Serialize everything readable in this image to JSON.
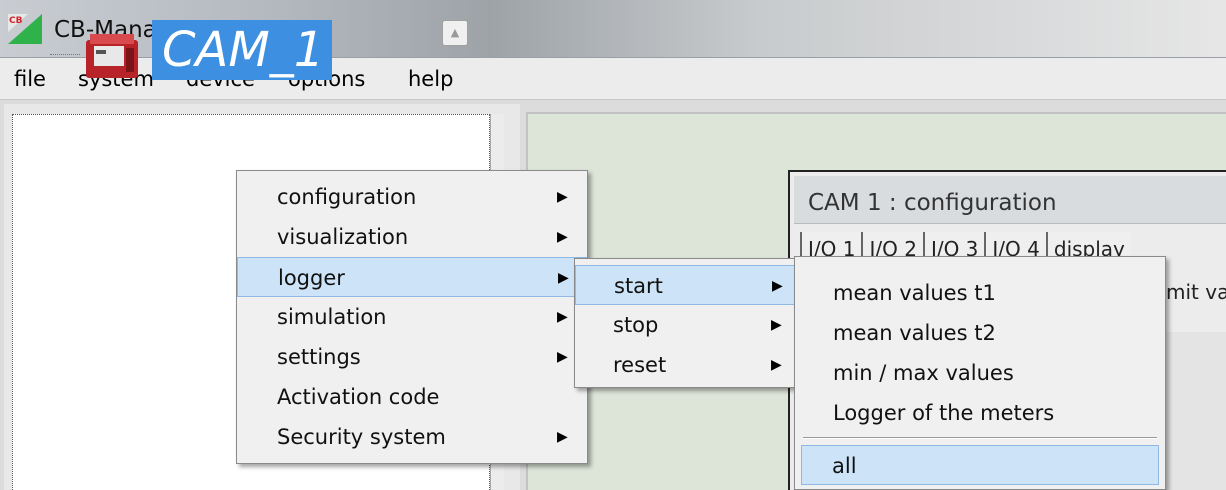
{
  "window": {
    "title": "CB-Manager",
    "logo_text": "CB"
  },
  "menubar": [
    "file",
    "system",
    "device",
    "options",
    "help"
  ],
  "tree": {
    "node_label": "CAM_1"
  },
  "config_window": {
    "title": "CAM 1  : configuration",
    "tabs": [
      "I/O 1",
      "I/O 2",
      "I/O 3",
      "I/O 4",
      "display"
    ],
    "sub_text": "mit va"
  },
  "context_menu": {
    "items": [
      {
        "label": "configuration",
        "submenu": true
      },
      {
        "label": "visualization",
        "submenu": true
      },
      {
        "label": "logger",
        "submenu": true,
        "highlighted": true
      },
      {
        "label": "simulation",
        "submenu": true
      },
      {
        "label": "settings",
        "submenu": true
      },
      {
        "label": "Activation code",
        "submenu": false
      },
      {
        "label": "Security system",
        "submenu": true
      }
    ]
  },
  "logger_submenu": {
    "items": [
      {
        "label": "start",
        "submenu": true,
        "highlighted": true
      },
      {
        "label": "stop",
        "submenu": true
      },
      {
        "label": "reset",
        "submenu": true
      }
    ]
  },
  "start_submenu": {
    "items": [
      {
        "label": "mean values t1"
      },
      {
        "label": "mean values t2"
      },
      {
        "label": "min / max values"
      },
      {
        "label": "Logger of the meters"
      },
      {
        "label": "all",
        "highlighted": true
      }
    ]
  },
  "colors": {
    "selection": "#3c8fe1",
    "menu_highlight": "#cde3f7"
  }
}
